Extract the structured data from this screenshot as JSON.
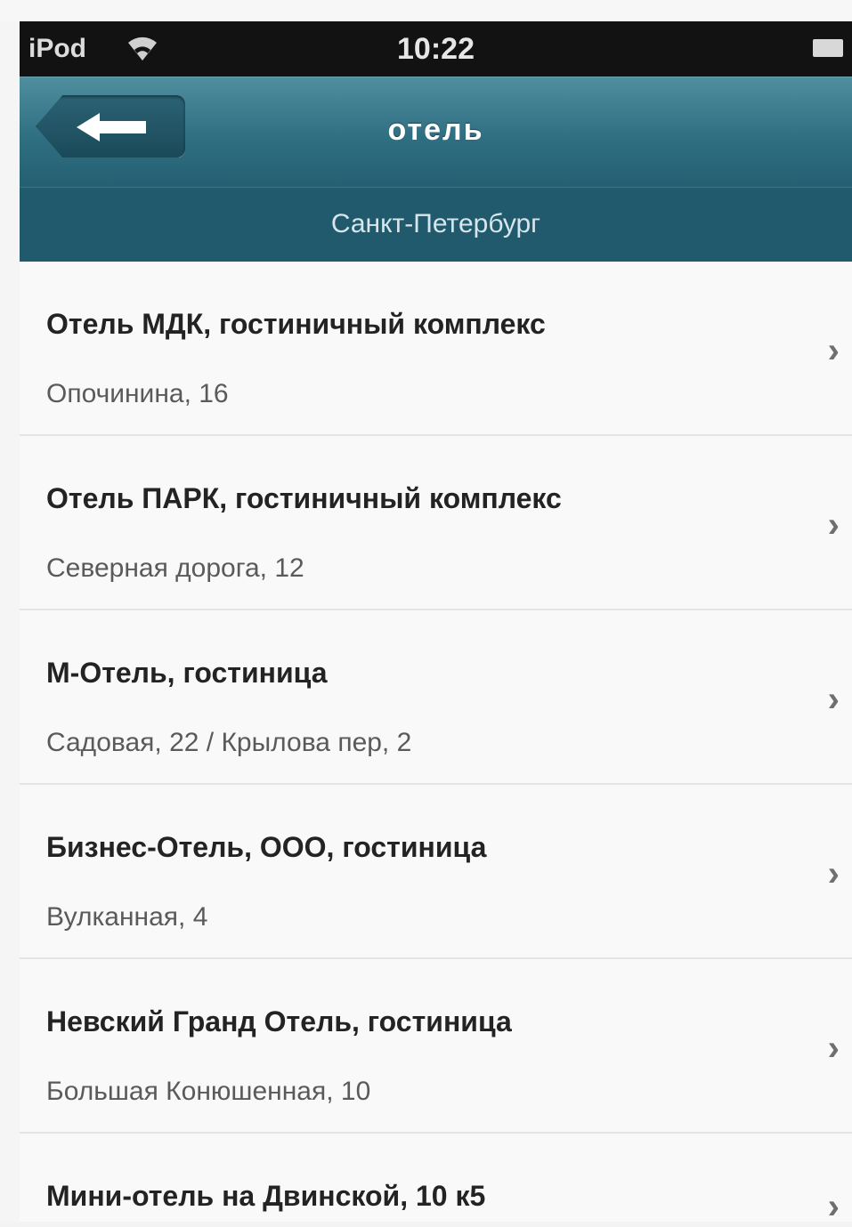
{
  "status_bar": {
    "carrier": "iPod",
    "time": "10:22"
  },
  "nav_bar": {
    "title": "отель",
    "subtitle": "Санкт-Петербург"
  },
  "hotels": [
    {
      "name": "Отель МДК, гостиничный комплекс",
      "address": "Опочинина, 16"
    },
    {
      "name": "Отель ПАРК, гостиничный комплекс",
      "address": "Северная дорога, 12"
    },
    {
      "name": "М-Отель, гостиница",
      "address": "Садовая, 22 / Крылова пер, 2"
    },
    {
      "name": "Бизнес-Отель, ООО, гостиница",
      "address": "Вулканная, 4"
    },
    {
      "name": "Невский Гранд Отель, гостиница",
      "address": "Большая Конюшенная, 10"
    },
    {
      "name": "Мини-отель на Двинской, 10 к5",
      "address": ""
    }
  ],
  "chevron_glyph": "›",
  "colors": {
    "nav_bar": "#2f6f82",
    "sub_bar": "#225a6d",
    "status_bar": "#121212"
  }
}
